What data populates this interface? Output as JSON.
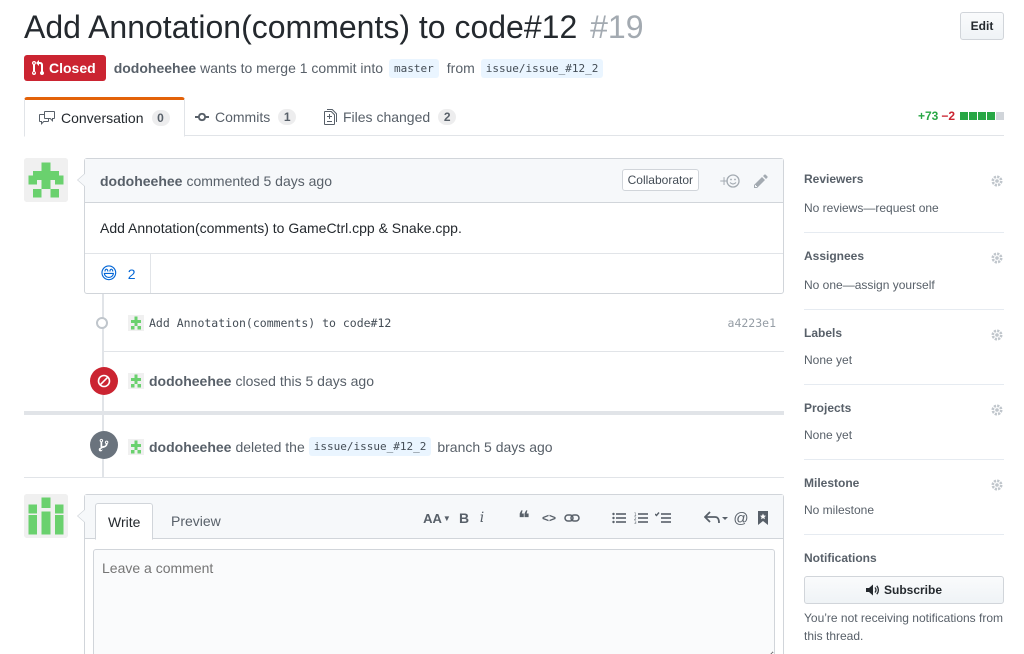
{
  "pr": {
    "title": "Add Annotation(comments) to code#12",
    "number": "#19",
    "edit_label": "Edit",
    "state": "Closed",
    "author": "dodoheehee",
    "merge_text": "wants to merge 1 commit into",
    "base_branch": "master",
    "from_text": "from",
    "head_branch": "issue/issue_#12_2"
  },
  "tabs": [
    {
      "label": "Conversation",
      "count": "0",
      "icon": "comment-discussion-icon"
    },
    {
      "label": "Commits",
      "count": "1",
      "icon": "git-commit-icon"
    },
    {
      "label": "Files changed",
      "count": "2",
      "icon": "file-diff-icon"
    }
  ],
  "diffstat": {
    "additions": "+73",
    "deletions": "−2",
    "add_color": "#28a745",
    "del_color": "#cb2431",
    "neutral_color": "#d1d5da"
  },
  "comment": {
    "author": "dodoheehee",
    "action": "commented 5 days ago",
    "role": "Collaborator",
    "body": "Add Annotation(comments) to GameCtrl.cpp & Snake.cpp.",
    "reaction_emoji": "😄",
    "reaction_count": "2"
  },
  "commit": {
    "message": "Add Annotation(comments) to code#12",
    "sha": "a4223e1"
  },
  "events": {
    "closed": {
      "author": "dodoheehee",
      "text": "closed this 5 days ago",
      "color": "#cb2431"
    },
    "deleted": {
      "author": "dodoheehee",
      "text_before": "deleted the",
      "branch": "issue/issue_#12_2",
      "text_after": "branch 5 days ago",
      "color": "#6a737d"
    }
  },
  "new_comment": {
    "write_tab": "Write",
    "preview_tab": "Preview",
    "placeholder": "Leave a comment",
    "toolbar": {
      "heading": "AA",
      "bold": "B",
      "italic": "i",
      "quote": "❝",
      "code": "<>",
      "at": "@"
    }
  },
  "sidebar": {
    "reviewers": {
      "title": "Reviewers",
      "value": "No reviews—request one"
    },
    "assignees": {
      "title": "Assignees",
      "value": "No one—assign yourself"
    },
    "labels": {
      "title": "Labels",
      "value": "None yet"
    },
    "projects": {
      "title": "Projects",
      "value": "None yet"
    },
    "milestone": {
      "title": "Milestone",
      "value": "No milestone"
    },
    "notifications": {
      "title": "Notifications",
      "subscribe_label": "Subscribe",
      "note": "You’re not receiving notifications from this thread."
    }
  }
}
